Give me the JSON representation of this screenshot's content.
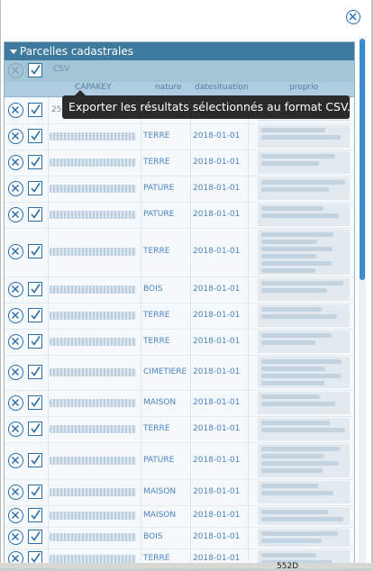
{
  "panel": {
    "close_icon": "close-circle-icon"
  },
  "layer": {
    "title": "Parcelles cadastrales",
    "toolbar": {
      "csv_label": "CSV"
    },
    "columns": [
      "CAPAKEY",
      "nature",
      "datesituation",
      "proprio"
    ],
    "rows": [
      {
        "capakey_partial": "250",
        "nature": "",
        "date": ""
      },
      {
        "nature": "TERRE",
        "date": "2018-01-01"
      },
      {
        "nature": "TERRE",
        "date": "2018-01-01"
      },
      {
        "nature": "PATURE",
        "date": "2018-01-01"
      },
      {
        "nature": "PATURE",
        "date": "2018-01-01"
      },
      {
        "nature": "TERRE",
        "date": "2018-01-01"
      },
      {
        "nature": "BOIS",
        "date": "2018-01-01"
      },
      {
        "nature": "TERRE",
        "date": "2018-01-01"
      },
      {
        "nature": "TERRE",
        "date": "2018-01-01"
      },
      {
        "nature": "CIMETIERE",
        "date": "2018-01-01"
      },
      {
        "nature": "MAISON",
        "date": "2018-01-01"
      },
      {
        "nature": "TERRE",
        "date": "2018-01-01"
      },
      {
        "nature": "PATURE",
        "date": "2018-01-01"
      },
      {
        "nature": "MAISON",
        "date": "2018-01-01"
      },
      {
        "nature": "MAISON",
        "date": "2018-01-01"
      },
      {
        "nature": "BOIS",
        "date": "2018-01-01"
      },
      {
        "nature": "TERRE",
        "date": "2018-01-01"
      }
    ]
  },
  "tooltip": {
    "text": "Exporter les résultats sélectionnés au format CSV."
  },
  "map": {
    "bottom_label": "552D"
  },
  "colors": {
    "header": "#3d7a9e",
    "toolbar": "#a3c5d6",
    "accent": "#2a6db3",
    "scroll": "#3b8bd0"
  }
}
